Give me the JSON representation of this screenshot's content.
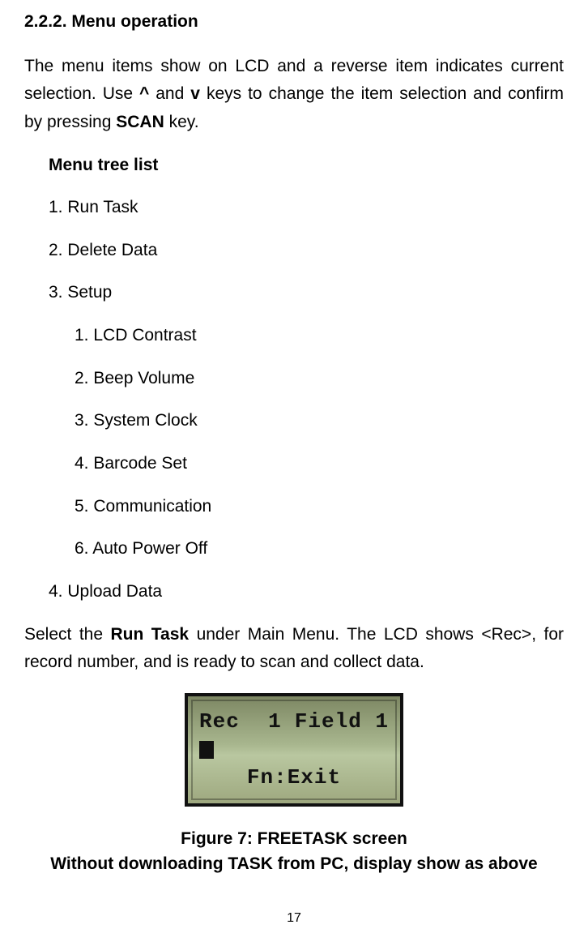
{
  "heading": "2.2.2. Menu operation",
  "intro": {
    "pre": "The menu items show on LCD and a reverse item indicates current selection. Use ",
    "b1": "^",
    "mid1": " and ",
    "b2": "v",
    "mid2": " keys to change the item selection and confirm by pressing ",
    "b3": "SCAN",
    "post": " key."
  },
  "menuTreeTitle": "Menu tree list",
  "menu": {
    "items": [
      "1. Run Task",
      "2. Delete Data",
      "3. Setup",
      "4. Upload Data"
    ],
    "subitems": [
      "1. LCD Contrast",
      "2. Beep Volume",
      "3. System Clock",
      "4. Barcode Set",
      "5. Communication",
      "6. Auto Power Off"
    ]
  },
  "selectPara": {
    "pre": "Select the ",
    "b1": "Run Task",
    "post": " under Main Menu. The LCD shows <Rec>, for record number, and is ready to scan and collect data."
  },
  "lcd": {
    "rec": "Rec",
    "one": "1",
    "field": "Field 1",
    "fn": "Fn:Exit"
  },
  "figureCaption": {
    "line1": "Figure 7: FREETASK screen",
    "line2": "Without downloading TASK from PC, display show as above"
  },
  "pageNumber": "17"
}
